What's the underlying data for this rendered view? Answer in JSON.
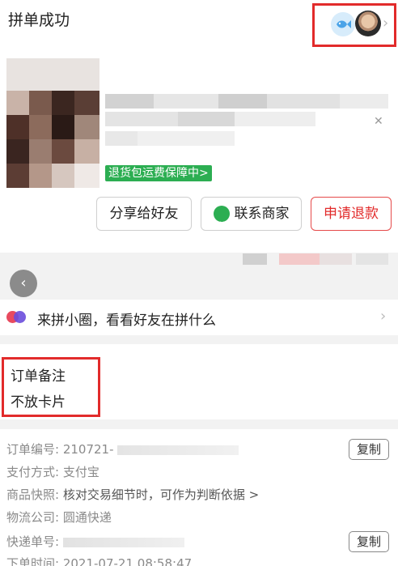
{
  "header": {
    "status_title": "拼单成功"
  },
  "product": {
    "guarantee_tag": "退货包运费保障中>"
  },
  "actions": {
    "share_label": "分享给好友",
    "contact_label": "联系商家",
    "refund_label": "申请退款"
  },
  "circle": {
    "text": "来拼小圈，看看好友在拼什么"
  },
  "note": {
    "label": "订单备注",
    "value": "不放卡片"
  },
  "order_info": {
    "order_no_label": "订单编号:",
    "order_no_value": "210721-",
    "copy_label": "复制",
    "payment_label": "支付方式:",
    "payment_value": "支付宝",
    "snapshot_label": "商品快照:",
    "snapshot_value": "核对交易细节时，可作为判断依据 >",
    "logistics_label": "物流公司:",
    "logistics_value": "圆通快递",
    "tracking_label": "快递单号:",
    "time_label": "下单时间:",
    "time_value": "2021-07-21 08:58:47"
  },
  "colors": {
    "accent_red": "#e22b2b",
    "green": "#2cae52",
    "text": "#222222",
    "muted": "#8a8a8a"
  }
}
